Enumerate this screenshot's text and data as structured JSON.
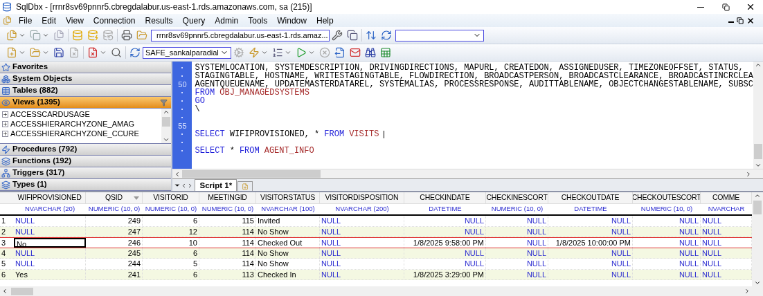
{
  "window": {
    "title": "SqlDbx - [rrnr8sv69pnnr5.cbregdalabur.us-east-1.rds.amazonaws.com, sa (215)]"
  },
  "menu": [
    "File",
    "Edit",
    "View",
    "Connection",
    "Results",
    "Query",
    "Admin",
    "Tools",
    "Window",
    "Help"
  ],
  "toolbar": {
    "connection": "rrnr8sv69pnnr5.cbregdalabur.us-east-1.rds.amaz...",
    "database": "SAFE_sankalparadial"
  },
  "sidebar": {
    "sections": [
      {
        "label": "Favorites",
        "selected": false
      },
      {
        "label": "System Objects",
        "selected": false
      },
      {
        "label": "Tables (882)",
        "selected": false
      },
      {
        "label": "Views (1395)",
        "selected": true,
        "items": [
          {
            "label": "ACCESSCARDUSAGE",
            "expanded": false
          },
          {
            "label": "ACCESSHIERARCHYZONE_AMAG",
            "expanded": false
          },
          {
            "label": "ACCESSHIERARCHYZONE_CCURE",
            "expanded": false
          }
        ]
      },
      {
        "label": "Procedures (792)",
        "selected": false
      },
      {
        "label": "Functions (192)",
        "selected": false
      },
      {
        "label": "Triggers (317)",
        "selected": false
      },
      {
        "label": "Types (1)",
        "selected": false
      }
    ]
  },
  "editor": {
    "lines": [
      {
        "cursor": false,
        "tokens": [
          {
            "kind": "ident",
            "text": "SYSTEMLOCATION, SYSTEMDESCRIPTION, DRIVINGDIRECTIONS, MAPURL, CREATEDON, ASSIGNEDUSER, TIMEZONEOFFSET, STATUS,"
          }
        ]
      },
      {
        "cursor": false,
        "tokens": [
          {
            "kind": "ident",
            "text": "STAGINGTABLE, HOSTNAME, WRITESTAGINGTABLE, FLOWDIRECTION, BROADCASTPERSON, BROADCASTCLEARANCE, BROADCASTINCRCLEA"
          }
        ]
      },
      {
        "number": "50",
        "cursor": false,
        "tokens": [
          {
            "kind": "ident",
            "text": "AGENTQUEUENAME, UPDATEMASTERDATAREL, SYSTEMALIAS, PROCESSRESPONSE, AUDITTABLENAME, OBJECTCHANGESTABLENAME, SUBSC"
          }
        ]
      },
      {
        "cursor": false,
        "tokens": [
          {
            "kind": "keyword",
            "text": "FROM"
          },
          {
            "kind": "table",
            "text": "OBJ_MANAGEDSYSTEMS"
          }
        ]
      },
      {
        "cursor": false,
        "tokens": [
          {
            "kind": "keyword",
            "text": "GO"
          }
        ]
      },
      {
        "cursor": false,
        "tokens": [
          {
            "kind": "ident",
            "text": "\\"
          }
        ]
      },
      {
        "cursor": false
      },
      {
        "number": "55",
        "cursor": false
      },
      {
        "cursor": true,
        "tokens": [
          {
            "kind": "keyword",
            "text": "SELECT"
          },
          {
            "kind": "ident",
            "text": "WIFIPROVISIONED, *"
          },
          {
            "kind": "keyword",
            "text": "FROM"
          },
          {
            "kind": "table",
            "text": "VISITS"
          }
        ]
      },
      {
        "cursor": false
      },
      {
        "cursor": false,
        "tokens": [
          {
            "kind": "keyword",
            "text": "SELECT"
          },
          {
            "kind": "ident",
            "text": "*"
          },
          {
            "kind": "keyword",
            "text": "FROM"
          },
          {
            "kind": "table",
            "text": "AGENT_INFO"
          }
        ]
      }
    ],
    "tabs": [
      {
        "label": "Script 1*",
        "selected": true
      }
    ]
  },
  "grid": {
    "columns": [
      {
        "name": "WIFIPROVISIONED",
        "type": "NVARCHAR (20)",
        "kind": "text",
        "filter_menu": false
      },
      {
        "name": "QSID",
        "type": "NUMERIC (10, 0)",
        "kind": "number",
        "filter_menu": true
      },
      {
        "name": "VISITORID",
        "type": "NUMERIC (10, 0)",
        "kind": "number",
        "filter_menu": false
      },
      {
        "name": "MEETINGID",
        "type": "NUMERIC (10, 0)",
        "kind": "number",
        "filter_menu": false
      },
      {
        "name": "VISITORSTATUS",
        "type": "NVARCHAR (100)",
        "kind": "text",
        "filter_menu": false
      },
      {
        "name": "VISITORDISPOSITION",
        "type": "NVARCHAR (200)",
        "kind": "text",
        "filter_menu": false
      },
      {
        "name": "CHECKINDATE",
        "type": "DATETIME",
        "kind": "date",
        "filter_menu": false
      },
      {
        "name": "CHECKINESCORT",
        "type": "NUMERIC (10, 0)",
        "kind": "number",
        "filter_menu": false
      },
      {
        "name": "CHECKOUTDATE",
        "type": "DATETIME",
        "kind": "date",
        "filter_menu": false
      },
      {
        "name": "CHECKOUTESCORT",
        "type": "NUMERIC (10, 0)",
        "kind": "number",
        "filter_menu": false
      },
      {
        "name": "COMME",
        "type": "NVARCHAR",
        "kind": "text",
        "filter_menu": false
      }
    ],
    "rows": [
      {
        "number": "1",
        "selected": false,
        "cells": [
          {
            "v": "NULL",
            "null": true,
            "current": false
          },
          {
            "v": "249",
            "null": false,
            "current": false
          },
          {
            "v": "6",
            "null": false,
            "current": false
          },
          {
            "v": "115",
            "null": false,
            "current": false
          },
          {
            "v": "Invited",
            "null": false,
            "current": false
          },
          {
            "v": "NULL",
            "null": true,
            "current": false
          },
          {
            "v": "NULL",
            "null": true,
            "current": false
          },
          {
            "v": "NULL",
            "null": true,
            "current": false
          },
          {
            "v": "NULL",
            "null": true,
            "current": false
          },
          {
            "v": "NULL",
            "null": true,
            "current": false
          },
          {
            "v": "NULL",
            "null": true,
            "current": false
          }
        ]
      },
      {
        "number": "2",
        "selected": false,
        "cells": [
          {
            "v": "NULL",
            "null": true,
            "current": false
          },
          {
            "v": "247",
            "null": false,
            "current": false
          },
          {
            "v": "12",
            "null": false,
            "current": false
          },
          {
            "v": "114",
            "null": false,
            "current": false
          },
          {
            "v": "No Show",
            "null": false,
            "current": false
          },
          {
            "v": "NULL",
            "null": true,
            "current": false
          },
          {
            "v": "NULL",
            "null": true,
            "current": false
          },
          {
            "v": "NULL",
            "null": true,
            "current": false
          },
          {
            "v": "NULL",
            "null": true,
            "current": false
          },
          {
            "v": "NULL",
            "null": true,
            "current": false
          },
          {
            "v": "NULL",
            "null": true,
            "current": false
          }
        ]
      },
      {
        "number": "3",
        "selected": true,
        "cells": [
          {
            "v": "No",
            "null": false,
            "current": true
          },
          {
            "v": "246",
            "null": false,
            "current": false
          },
          {
            "v": "10",
            "null": false,
            "current": false
          },
          {
            "v": "114",
            "null": false,
            "current": false
          },
          {
            "v": "Checked Out",
            "null": false,
            "current": false
          },
          {
            "v": "NULL",
            "null": true,
            "current": false
          },
          {
            "v": "1/8/2025 9:58:00 PM",
            "null": false,
            "current": false
          },
          {
            "v": "NULL",
            "null": true,
            "current": false
          },
          {
            "v": "1/8/2025 10:00:00 PM",
            "null": false,
            "current": false
          },
          {
            "v": "NULL",
            "null": true,
            "current": false
          },
          {
            "v": "NULL",
            "null": true,
            "current": false
          }
        ]
      },
      {
        "number": "4",
        "selected": false,
        "cells": [
          {
            "v": "NULL",
            "null": true,
            "current": false
          },
          {
            "v": "245",
            "null": false,
            "current": false
          },
          {
            "v": "6",
            "null": false,
            "current": false
          },
          {
            "v": "114",
            "null": false,
            "current": false
          },
          {
            "v": "No Show",
            "null": false,
            "current": false
          },
          {
            "v": "NULL",
            "null": true,
            "current": false
          },
          {
            "v": "NULL",
            "null": true,
            "current": false
          },
          {
            "v": "NULL",
            "null": true,
            "current": false
          },
          {
            "v": "NULL",
            "null": true,
            "current": false
          },
          {
            "v": "NULL",
            "null": true,
            "current": false
          },
          {
            "v": "NULL",
            "null": true,
            "current": false
          }
        ]
      },
      {
        "number": "5",
        "selected": false,
        "cells": [
          {
            "v": "NULL",
            "null": true,
            "current": false
          },
          {
            "v": "244",
            "null": false,
            "current": false
          },
          {
            "v": "5",
            "null": false,
            "current": false
          },
          {
            "v": "114",
            "null": false,
            "current": false
          },
          {
            "v": "No Show",
            "null": false,
            "current": false
          },
          {
            "v": "NULL",
            "null": true,
            "current": false
          },
          {
            "v": "NULL",
            "null": true,
            "current": false
          },
          {
            "v": "NULL",
            "null": true,
            "current": false
          },
          {
            "v": "NULL",
            "null": true,
            "current": false
          },
          {
            "v": "NULL",
            "null": true,
            "current": false
          },
          {
            "v": "NULL",
            "null": true,
            "current": false
          }
        ]
      },
      {
        "number": "6",
        "selected": false,
        "cells": [
          {
            "v": "Yes",
            "null": false,
            "current": false
          },
          {
            "v": "241",
            "null": false,
            "current": false
          },
          {
            "v": "6",
            "null": false,
            "current": false
          },
          {
            "v": "113",
            "null": false,
            "current": false
          },
          {
            "v": "Checked In",
            "null": false,
            "current": false
          },
          {
            "v": "NULL",
            "null": true,
            "current": false
          },
          {
            "v": "1/8/2025 3:29:00 PM",
            "null": false,
            "current": false
          },
          {
            "v": "NULL",
            "null": true,
            "current": false
          },
          {
            "v": "NULL",
            "null": true,
            "current": false
          },
          {
            "v": "NULL",
            "null": true,
            "current": false
          },
          {
            "v": "NULL",
            "null": true,
            "current": false
          }
        ]
      }
    ]
  }
}
